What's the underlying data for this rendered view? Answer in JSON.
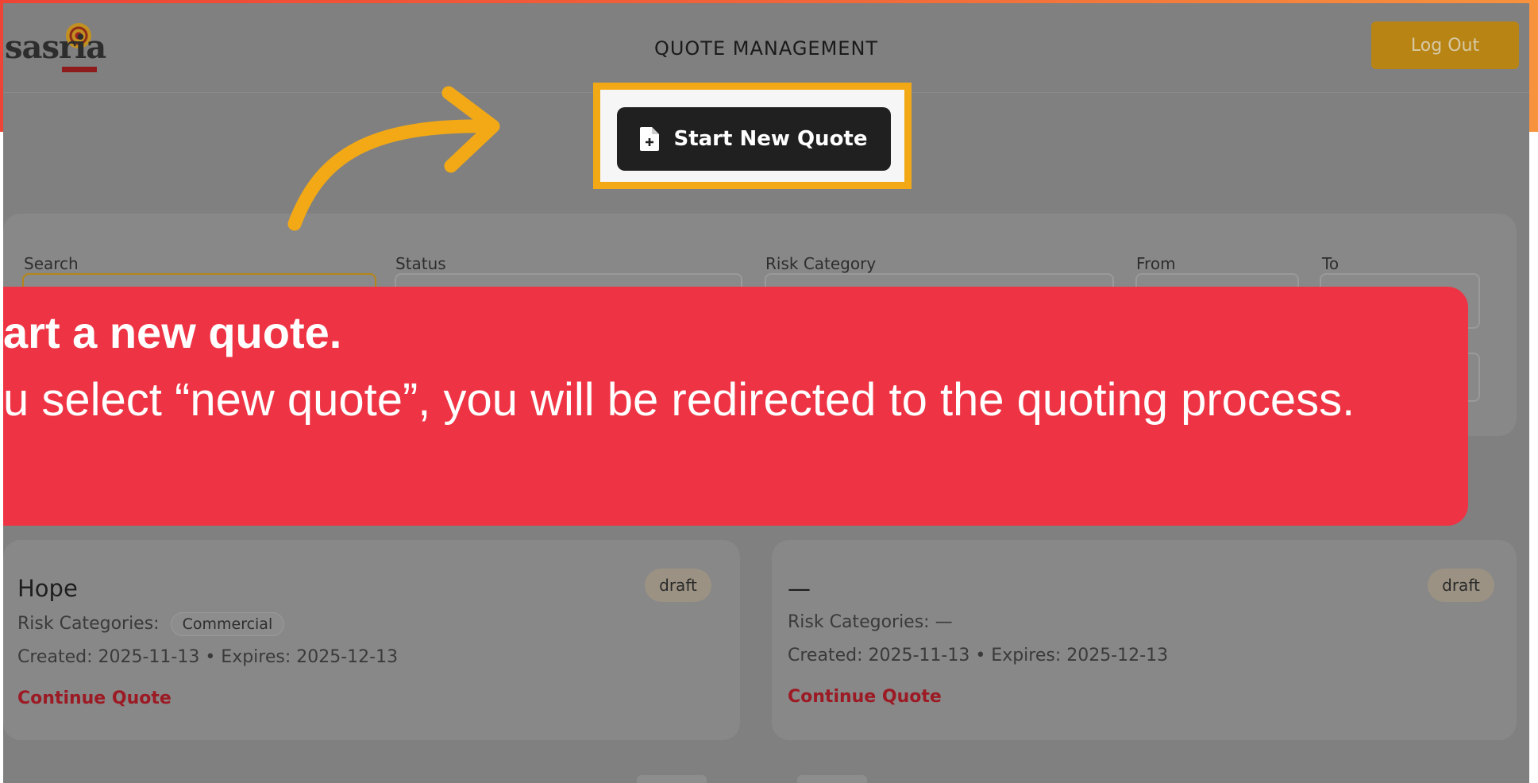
{
  "header": {
    "logo_text": "sasria",
    "title": "QUOTE MANAGEMENT",
    "logout_label": "Log Out"
  },
  "actions": {
    "start_new_quote_label": "Start New Quote"
  },
  "filters": {
    "search_label": "Search",
    "status_label": "Status",
    "risk_category_label": "Risk Category",
    "from_label": "From",
    "to_label": "To"
  },
  "banner": {
    "title": "art a new quote.",
    "body": "u select “new quote”, you will be redirected to the quoting process."
  },
  "quotes": [
    {
      "name": "Hope",
      "status": "draft",
      "risk_label": "Risk Categories:",
      "risk_value": "Commercial",
      "dates": "Created: 2025-11-13 • Expires: 2025-12-13",
      "action": "Continue Quote"
    },
    {
      "name": "—",
      "status": "draft",
      "risk_label": "Risk Categories:",
      "risk_value": "—",
      "dates": "Created: 2025-11-13 • Expires: 2025-12-13",
      "action": "Continue Quote"
    }
  ],
  "icons": {
    "start_quote": "file-plus-icon",
    "tutorial_arrow": "curved-arrow-icon"
  },
  "colors": {
    "highlight": "#f2a915",
    "banner": "#ee3444",
    "logout": "#b88414",
    "accent_link": "#9c1a24"
  }
}
